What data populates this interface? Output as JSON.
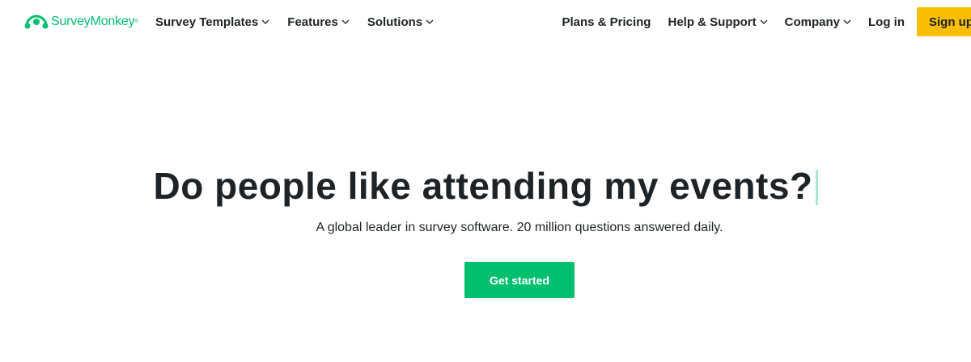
{
  "brand": {
    "name": "SurveyMonkey",
    "trademark": "®",
    "color": "#00bf6f",
    "icon": "surveymonkey-logo-icon"
  },
  "nav": {
    "left": [
      {
        "label": "Survey Templates",
        "icon": "chevron-down-icon"
      },
      {
        "label": "Features",
        "icon": "chevron-down-icon"
      },
      {
        "label": "Solutions",
        "icon": "chevron-down-icon"
      }
    ],
    "right": [
      {
        "label": "Plans & Pricing"
      },
      {
        "label": "Help & Support",
        "icon": "chevron-down-icon"
      },
      {
        "label": "Company",
        "icon": "chevron-down-icon"
      },
      {
        "label": "Log in"
      }
    ],
    "signup_label": "Sign up",
    "signup_color": "#f9be00"
  },
  "hero": {
    "title": "Do people like attending my events?",
    "subtitle": "A global leader in survey software. 20 million questions answered daily.",
    "cta_label": "Get started",
    "cta_color": "#00bf6f"
  }
}
